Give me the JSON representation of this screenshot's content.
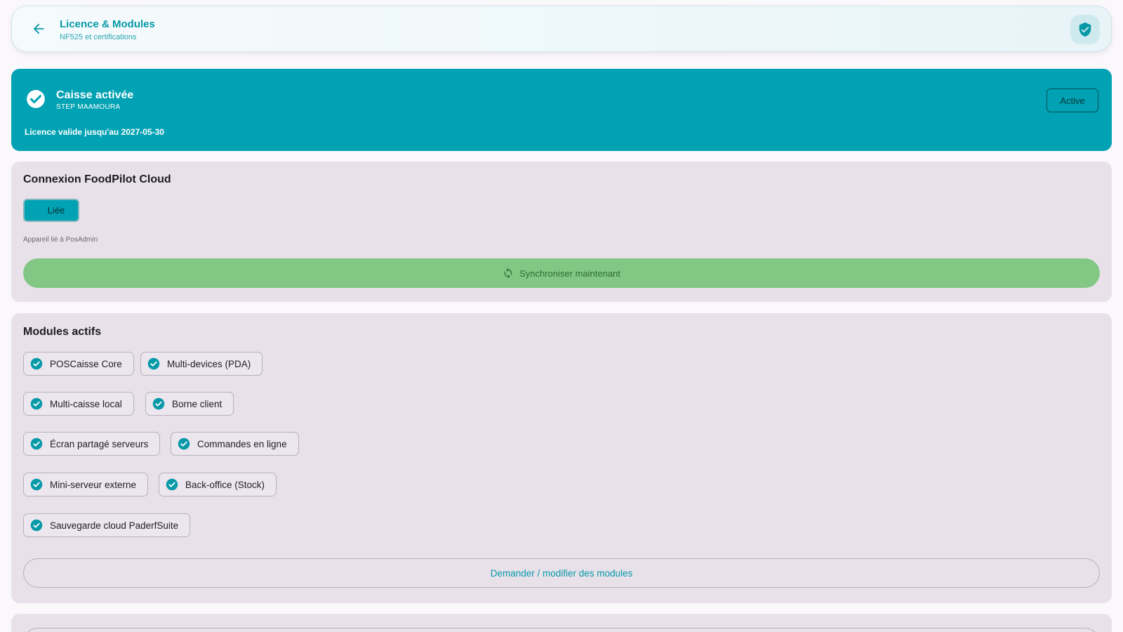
{
  "header": {
    "title": "Licence & Modules",
    "subtitle": "NF525 et certifications",
    "back_icon": "arrow-back-icon",
    "badge_icon": "verified-shield-icon",
    "accent": "#0799a8"
  },
  "licence": {
    "title": "Caisse activée",
    "store": "STEP MAAMOURA",
    "validity": "Licence valide jusqu'au 2027-05-30",
    "status_button": "Active",
    "color": "#00a2b3"
  },
  "cloud": {
    "title": "Connexion FoodPilot Cloud",
    "linked_label": "Liée",
    "description": "Appareil lié à PosAdmin",
    "sync_label": "Synchroniser maintenant",
    "sync_color": "#82c884"
  },
  "modules": {
    "title": "Modules actifs",
    "items": [
      "POSCaisse Core",
      "Multi-devices (PDA)",
      "Multi-caisse local",
      "Borne client",
      "Écran partagé serveurs",
      "Commandes en ligne",
      "Mini-serveur externe",
      "Back-office (Stock)",
      "Sauvegarde cloud PaderfSuite"
    ],
    "modify_label": "Demander / modifier des modules"
  }
}
